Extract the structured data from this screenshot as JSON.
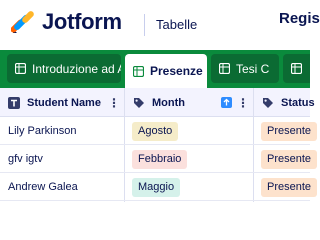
{
  "header": {
    "logo_text": "Jotform",
    "product_name": "Tabelle",
    "page_title": "Regis"
  },
  "tabs": [
    {
      "label": "Introduzione ad A",
      "active": false
    },
    {
      "label": "Presenze",
      "active": true
    },
    {
      "label": "Tesi C",
      "active": false
    },
    {
      "label": "",
      "active": false
    }
  ],
  "columns": [
    {
      "label": "Student Name",
      "icon": "text-field-icon"
    },
    {
      "label": "Month",
      "icon": "tag-icon"
    },
    {
      "label": "Status",
      "icon": "tag-icon"
    }
  ],
  "rows": [
    {
      "name": "Lily Parkinson",
      "month": "Agosto",
      "status": "Presente"
    },
    {
      "name": "gfv igtv",
      "month": "Febbraio",
      "status": "Presente"
    },
    {
      "name": "Andrew Galea",
      "month": "Maggio",
      "status": "Presente"
    }
  ],
  "colors": {
    "brand_green": "#0a8a3c",
    "navy": "#0a1551",
    "badge_agosto": "#f5ecc9",
    "badge_febbraio": "#fbe0dd",
    "badge_maggio": "#d5f1ea",
    "badge_presente": "#fde2cc",
    "sort_blue": "#2e8cff"
  }
}
